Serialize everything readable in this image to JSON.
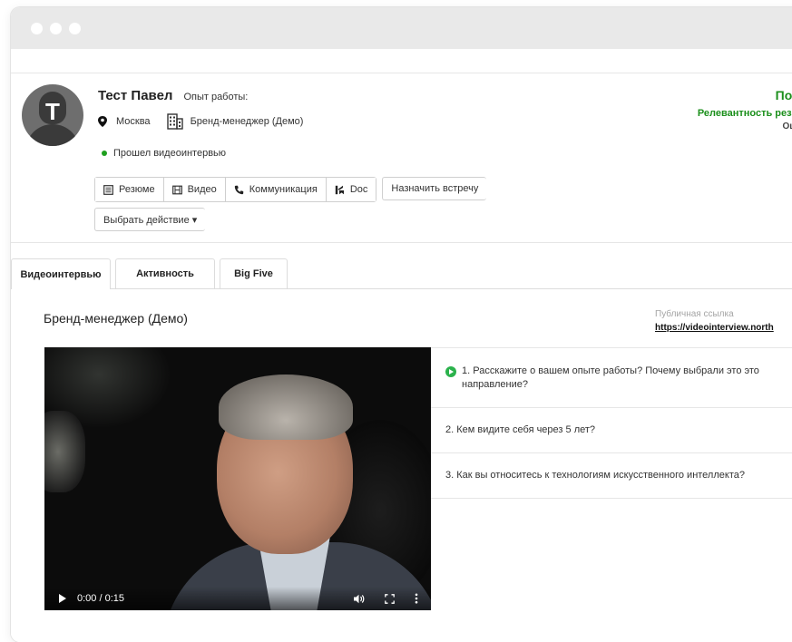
{
  "candidate": {
    "name": "Тест Павел",
    "experience_label": "Опыт работы:",
    "avatar_letter": "T",
    "city": "Москва",
    "position": "Бренд-менеджер (Демо)",
    "status": "Прошел видеоинтервью"
  },
  "actions": {
    "buttons": [
      "Резюме",
      "Видео",
      "Коммуникация",
      "Doc"
    ],
    "schedule": "Назначить встречу",
    "choose_action": "Выбрать действие ▾"
  },
  "relevance": {
    "title": "Под",
    "subtitle": "Релевантность резю",
    "score_label": "Оце"
  },
  "tabs": [
    "Видеоинтервью",
    "Активность",
    "Big Five"
  ],
  "interview": {
    "title": "Бренд-менеджер (Демо)",
    "public_label": "Публичная ссылка",
    "public_link": "https://videointerview.north",
    "video_time": "0:00 / 0:15",
    "questions": [
      "1. Расскажите о вашем опыте работы? Почему выбрали это это направление?",
      "2. Кем видите себя через 5 лет?",
      "3. Как вы относитесь к технологиям искусственного интеллекта?"
    ]
  },
  "colors": {
    "accent_green": "#1b8f1b",
    "status_dot": "#1fa01f",
    "titlebar": "#e9e9e9"
  }
}
